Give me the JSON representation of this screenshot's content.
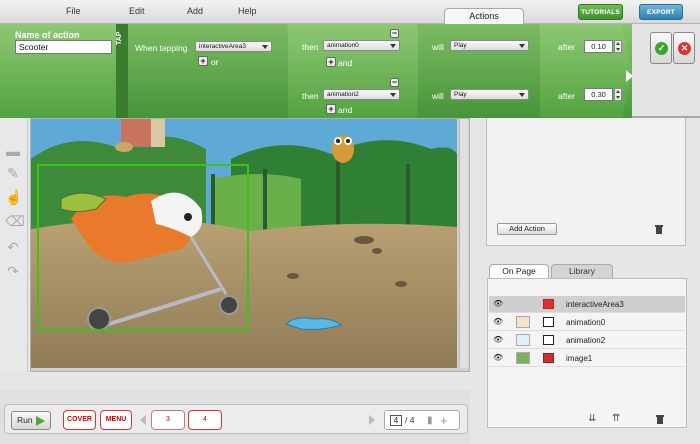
{
  "menubar": {
    "items": [
      "File",
      "Edit",
      "Add",
      "Help"
    ],
    "active_tab": "Actions",
    "tutorials_label": "TUTORIALS",
    "export_label": "EXPORT"
  },
  "action": {
    "name_label": "Name of action",
    "name_value": "Scooter",
    "trigger_tag": "TAP",
    "when_label": "When tapping",
    "target": "interactiveArea3",
    "or_label": "or",
    "rows": [
      {
        "then_label": "then",
        "object": "animation0",
        "and_label": "and",
        "will_label": "will",
        "verb": "Play",
        "after_label": "after",
        "delay": "0.10"
      },
      {
        "then_label": "then",
        "object": "animation2",
        "and_label": "and",
        "will_label": "will",
        "verb": "Play",
        "after_label": "after",
        "delay": "0.30"
      }
    ]
  },
  "right_panel": {
    "add_action_label": "Add Action",
    "tabs": [
      "On Page",
      "Library"
    ],
    "layers": [
      {
        "name": "interactiveArea3",
        "selected": true,
        "type_color": "#e53030"
      },
      {
        "name": "animation0",
        "selected": false,
        "type_color": "#222222"
      },
      {
        "name": "animation2",
        "selected": false,
        "type_color": "#222222"
      },
      {
        "name": "image1",
        "selected": false,
        "type_color": "#c83232"
      }
    ]
  },
  "bottom": {
    "run_label": "Run",
    "cover_label": "COVER",
    "menu_label": "MENU",
    "pages": [
      "3",
      "4"
    ],
    "current_page": "4",
    "total_pages": "/ 4"
  },
  "colors": {
    "action_green": "#5aa848",
    "tutorials_green": "#4fa83d",
    "export_blue": "#2b7fb0",
    "selection_green": "#3ec21a"
  }
}
